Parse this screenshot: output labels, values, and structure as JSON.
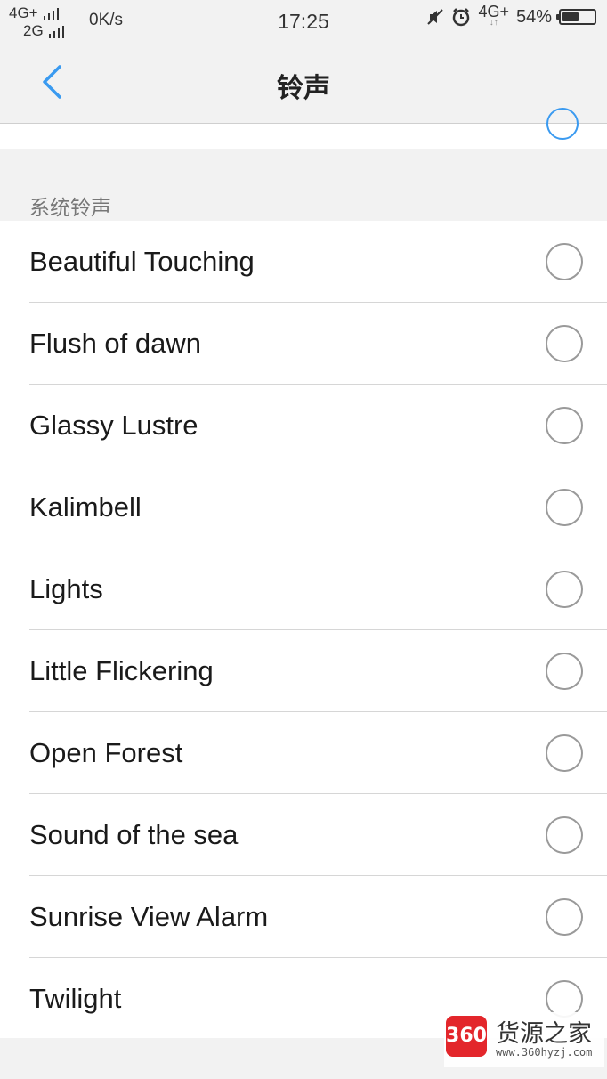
{
  "status_bar": {
    "network_top": "4G+",
    "network_bottom": "2G",
    "speed": "0K/s",
    "time": "17:25",
    "network_right": "4G+",
    "battery_percent": "54%",
    "battery_level": 0.54,
    "icons": [
      "mute-icon",
      "alarm-icon",
      "battery-icon"
    ]
  },
  "header": {
    "title": "铃声",
    "back_icon": "chevron-left-icon",
    "accent_color": "#3a9af0"
  },
  "section": {
    "label": "系统铃声"
  },
  "ringtones": [
    {
      "name": "Beautiful Touching",
      "selected": false
    },
    {
      "name": "Flush of dawn",
      "selected": false
    },
    {
      "name": "Glassy Lustre",
      "selected": false
    },
    {
      "name": "Kalimbell",
      "selected": false
    },
    {
      "name": "Lights",
      "selected": false
    },
    {
      "name": "Little Flickering",
      "selected": false
    },
    {
      "name": "Open Forest",
      "selected": false
    },
    {
      "name": "Sound of the sea",
      "selected": false
    },
    {
      "name": "Sunrise View Alarm",
      "selected": false
    },
    {
      "name": "Twilight",
      "selected": false
    }
  ],
  "watermark": {
    "badge": "360",
    "brand": "货源之家",
    "url": "www.360hyzj.com"
  }
}
